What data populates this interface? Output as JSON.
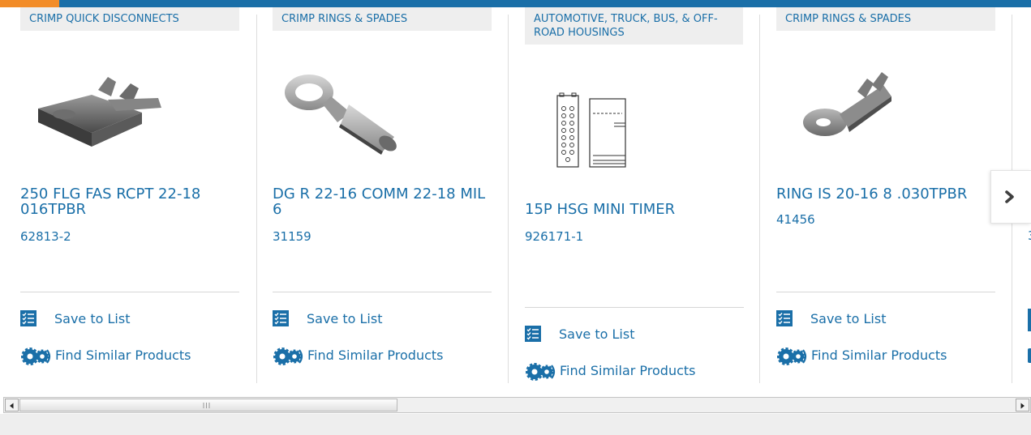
{
  "products": [
    {
      "category": "CRIMP QUICK DISCONNECTS",
      "name": "250 FLG FAS RCPT 22-18 016TPBR",
      "number": "62813-2"
    },
    {
      "category": "CRIMP RINGS & SPADES",
      "name": "DG R 22-16 COMM 22-18 MIL 6",
      "number": "31159"
    },
    {
      "category": "AUTOMOTIVE, TRUCK, BUS, & OFF-ROAD HOUSINGS",
      "name": "15P HSG MINI TIMER",
      "number": "926171-1"
    },
    {
      "category": "CRIMP RINGS & SPADES",
      "name": "RING IS 20-16 8 .030TPBR",
      "number": "41456"
    }
  ],
  "peek": {
    "number": "3"
  },
  "actions": {
    "save_label": "Save to List",
    "find_label": "Find Similar Products"
  },
  "icons": {
    "save": "checklist-icon",
    "find": "gears-icon",
    "next": "chevron-right-icon"
  },
  "colors": {
    "link": "#1a6fa8",
    "top_bar": "#1a6fa8",
    "accent": "#f28c28",
    "category_bg": "#eeeeee"
  }
}
